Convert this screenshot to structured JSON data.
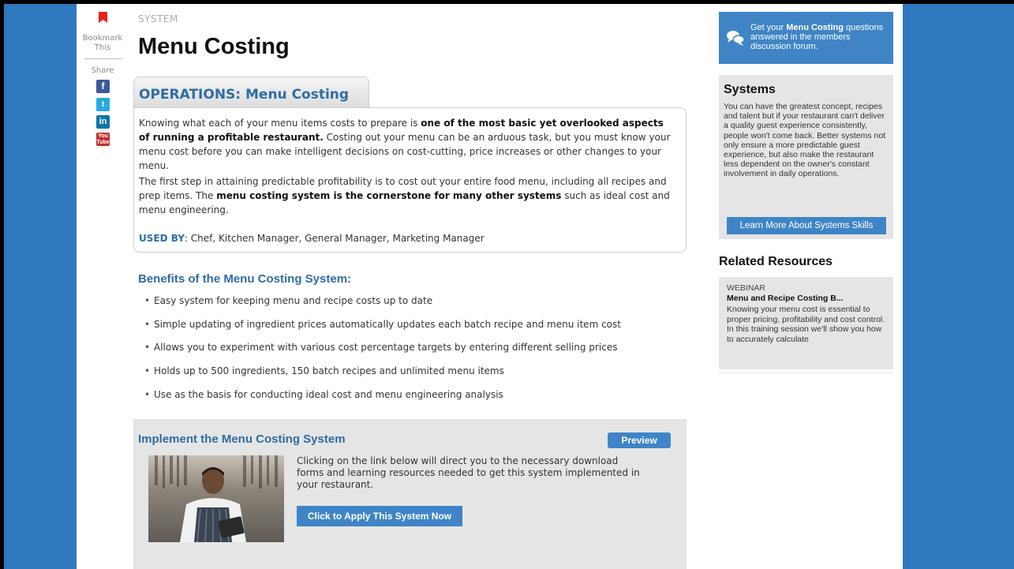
{
  "share": {
    "bookmark_label": "Bookmark This",
    "share_label": "Share",
    "icons": [
      "bookmark-icon",
      "facebook-icon",
      "twitter-icon",
      "linkedin-icon",
      "youtube-icon"
    ],
    "facebook_glyph": "f",
    "twitter_glyph": "t",
    "linkedin_glyph": "in",
    "youtube_glyph": "You Tube"
  },
  "header": {
    "kicker": "SYSTEM",
    "title": "Menu Costing"
  },
  "operations": {
    "tab_title": "OPERATIONS: Menu Costing",
    "p1_a": "Knowing what each of your menu items costs to prepare is ",
    "p1_bold": "one of the most basic yet overlooked aspects of running a profitable restaurant.",
    "p1_b": " Costing out your menu can be an arduous task, but you must know your menu cost before you can make intelligent decisions on cost-cutting, price increases or other changes to your menu.",
    "p2_a": "The first step in attaining predictable profitability is to cost out your entire food menu, including all recipes and prep items. The ",
    "p2_bold": "menu costing system is the cornerstone for many other systems",
    "p2_b": " such as ideal cost and menu engineering.",
    "used_by_label": "USED BY",
    "used_by_value": ": Chef, Kitchen Manager, General Manager, Marketing Manager"
  },
  "benefits": {
    "title": "Benefits of the Menu Costing System:",
    "items": [
      "Easy system for keeping menu and recipe costs up to date",
      "Simple updating of ingredient prices automatically updates each batch recipe and menu item cost",
      "Allows you to experiment with various cost percentage targets by entering different selling prices",
      "Holds up to 500 ingredients, 150 batch recipes and unlimited menu items",
      "Use as the basis for conducting ideal cost and menu engineering analysis"
    ]
  },
  "implement": {
    "title": "Implement the Menu Costing System",
    "preview_label": "Preview",
    "text": "Clicking on the link below will direct you to the necessary download forms and learning resources needed to get this system implemented in your restaurant.",
    "apply_label": "Click to Apply This System Now"
  },
  "sidebar": {
    "forum_pre": "Get your ",
    "forum_bold": "Menu Costing",
    "forum_post": " questions answered in the members discussion forum.",
    "systems_title": "Systems",
    "systems_text": "You can have the greatest concept, recipes and talent but if your restaurant can't deliver a quality guest experience consistently, people won't come back. Better systems not only ensure a more predictable guest experience, but also make the restaurant less dependent on the owner's constant involvement in daily operations.",
    "learn_label": "Learn More About Systems Skills",
    "related_title": "Related Resources",
    "resource_type": "WEBINAR",
    "resource_name": "Menu and Recipe Costing B...",
    "resource_desc": "Knowing your menu cost is essential to proper pricing, profitability and cost control. In this training session we'll show you how to accurately calculate"
  },
  "colors": {
    "background": "#2f78c0",
    "accent_blue": "#3f85c6",
    "heading_blue": "#2e6da4",
    "panel_gray": "#e5e5e5",
    "bookmark_red": "#e8211c"
  }
}
